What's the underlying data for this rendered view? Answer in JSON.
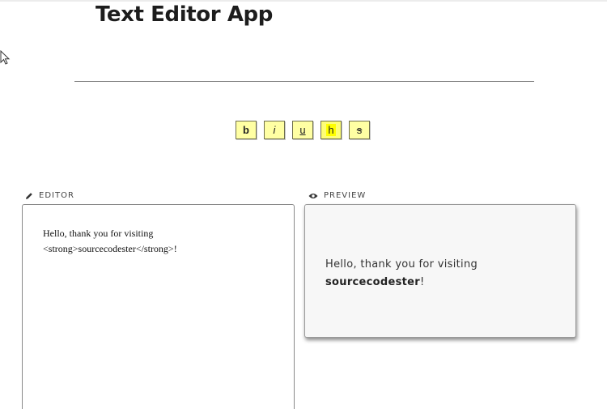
{
  "app": {
    "title": "Text Editor App"
  },
  "toolbar": {
    "buttons": [
      {
        "label": "b",
        "action": "bold"
      },
      {
        "label": "i",
        "action": "italic"
      },
      {
        "label": "u",
        "action": "underline"
      },
      {
        "label": "h",
        "action": "highlight"
      },
      {
        "label": "s",
        "action": "strikethrough"
      }
    ],
    "button_color": "#ffffa3",
    "highlight_color": "#ffff00"
  },
  "editor": {
    "label": "EDITOR",
    "icon": "pencil-icon",
    "value": "Hello, thank you for visiting\n<strong>sourcecodester</strong>!"
  },
  "preview": {
    "label": "PREVIEW",
    "icon": "eye-icon",
    "text_before": "Hello, thank you for visiting",
    "strong_text": "sourcecodester",
    "text_after": "!"
  }
}
